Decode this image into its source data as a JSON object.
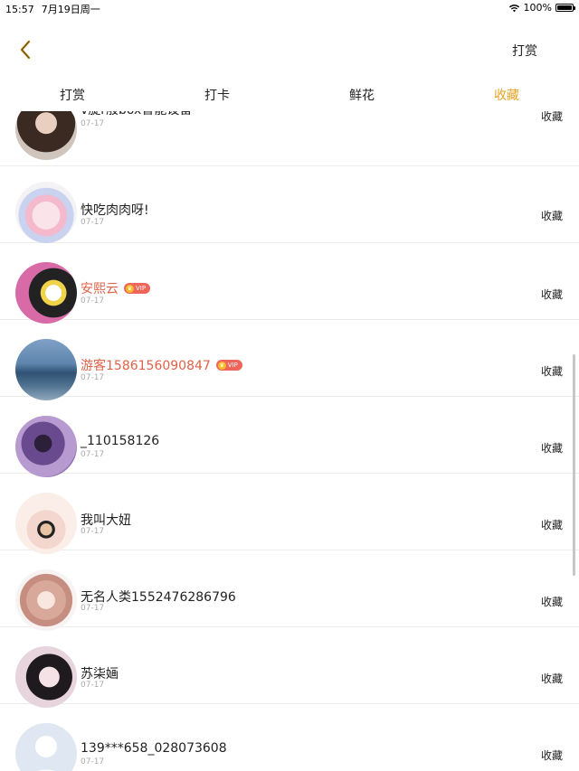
{
  "status": {
    "time": "15:57",
    "date": "7月19日周一",
    "battery": "100%"
  },
  "nav": {
    "back_icon": "chevron-left-icon",
    "action_label": "打赏"
  },
  "tabs": [
    {
      "label": "打赏",
      "active": false
    },
    {
      "label": "打卡",
      "active": false
    },
    {
      "label": "鲜花",
      "active": false
    },
    {
      "label": "收藏",
      "active": true
    }
  ],
  "colors": {
    "accent": "#e5a322",
    "vip_name": "#de6248",
    "vip_badge": "#f0655a"
  },
  "vip_text": "VIP",
  "list": [
    {
      "name": "v旋r般box智能设备",
      "date": "07-17",
      "action": "收藏",
      "vip": false
    },
    {
      "name": "快吃肉肉呀!",
      "date": "07-17",
      "action": "收藏",
      "vip": false
    },
    {
      "name": "安熙云",
      "date": "07-17",
      "action": "收藏",
      "vip": true
    },
    {
      "name": "游客1586156090847",
      "date": "07-17",
      "action": "收藏",
      "vip": true
    },
    {
      "name": "_110158126",
      "date": "07-17",
      "action": "收藏",
      "vip": false
    },
    {
      "name": "我叫大妞",
      "date": "07-17",
      "action": "收藏",
      "vip": false
    },
    {
      "name": "无名人类1552476286796",
      "date": "07-17",
      "action": "收藏",
      "vip": false
    },
    {
      "name": "苏柒婳",
      "date": "07-17",
      "action": "收藏",
      "vip": false
    },
    {
      "name": "139***658_028073608",
      "date": "07-17",
      "action": "收藏",
      "vip": false
    }
  ]
}
